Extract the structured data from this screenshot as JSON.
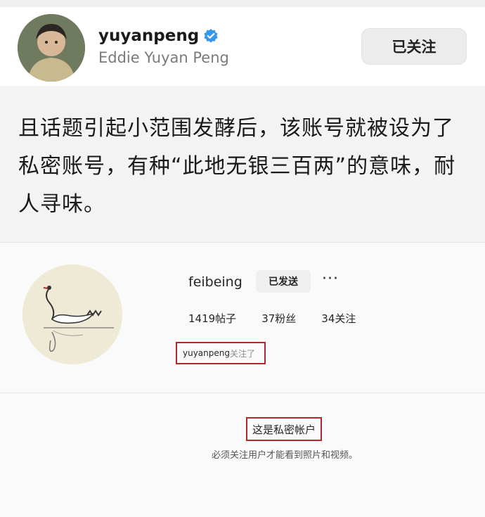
{
  "header": {
    "username": "yuyanpeng",
    "full_name": "Eddie Yuyan Peng",
    "follow_button": "已关注",
    "accent_color": "#3897f0"
  },
  "caption": {
    "text": "且话题引起小范围发酵后，该账号就被设为了私密账号，有种“此地无银三百两”的意味，耐人寻味。"
  },
  "profile": {
    "handle": "feibeing",
    "sent_button": "已发送",
    "more": "···",
    "stats": {
      "posts": "1419帖子",
      "followers": "37粉丝",
      "following": "34关注"
    },
    "followed_by_user": "yuyanpeng",
    "followed_by_suffix": "关注了"
  },
  "private_notice": {
    "title": "这是私密帐户",
    "description": "必须关注用户才能看到照片和视频。"
  },
  "colors": {
    "highlight_box": "#b3262c",
    "background_gray": "#f3f3f3"
  }
}
